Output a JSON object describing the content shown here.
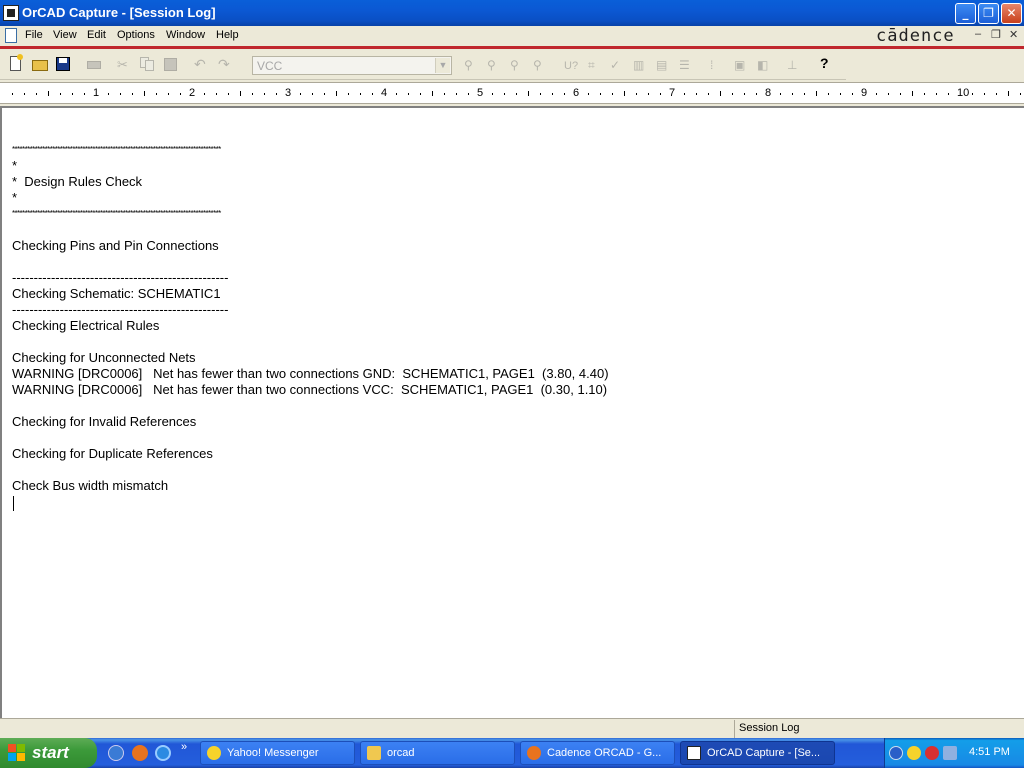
{
  "window": {
    "title": "OrCAD Capture - [Session Log]",
    "brand": "cādence"
  },
  "menu": {
    "items": [
      "File",
      "View",
      "Edit",
      "Options",
      "Window",
      "Help"
    ]
  },
  "toolbar": {
    "part_combo_value": "VCC",
    "help_icon": "?"
  },
  "ruler": {
    "numbers": [
      "1",
      "2",
      "3",
      "4",
      "5",
      "6",
      "7",
      "8",
      "9",
      "10"
    ]
  },
  "log": {
    "lines": [
      "***********************************************************************************",
      "*",
      "*  Design Rules Check",
      "*",
      "***********************************************************************************",
      "",
      "Checking Pins and Pin Connections",
      "",
      "--------------------------------------------------",
      "Checking Schematic: SCHEMATIC1",
      "--------------------------------------------------",
      "Checking Electrical Rules",
      "",
      "Checking for Unconnected Nets",
      "WARNING [DRC0006]   Net has fewer than two connections GND:  SCHEMATIC1, PAGE1  (3.80, 4.40)",
      "WARNING [DRC0006]   Net has fewer than two connections VCC:  SCHEMATIC1, PAGE1  (0.30, 1.10)",
      "",
      "Checking for Invalid References",
      "",
      "Checking for Duplicate References",
      "",
      "Check Bus width mismatch"
    ]
  },
  "status": {
    "pane": "Session Log"
  },
  "taskbar": {
    "start_label": "start",
    "chevron": "»",
    "tasks": [
      {
        "label": "Yahoo! Messenger",
        "icon": "yahoo-messenger-icon"
      },
      {
        "label": "orcad",
        "icon": "folder-icon"
      },
      {
        "label": "Cadence ORCAD - G...",
        "icon": "firefox-icon"
      },
      {
        "label": "OrCAD Capture - [Se...",
        "icon": "orcad-icon"
      }
    ],
    "clock": "4:51 PM"
  },
  "colors": {
    "titlebar": "#0a5fd8",
    "separator": "#c0272d",
    "taskbar": "#245edc",
    "start": "#3c9a3a"
  }
}
